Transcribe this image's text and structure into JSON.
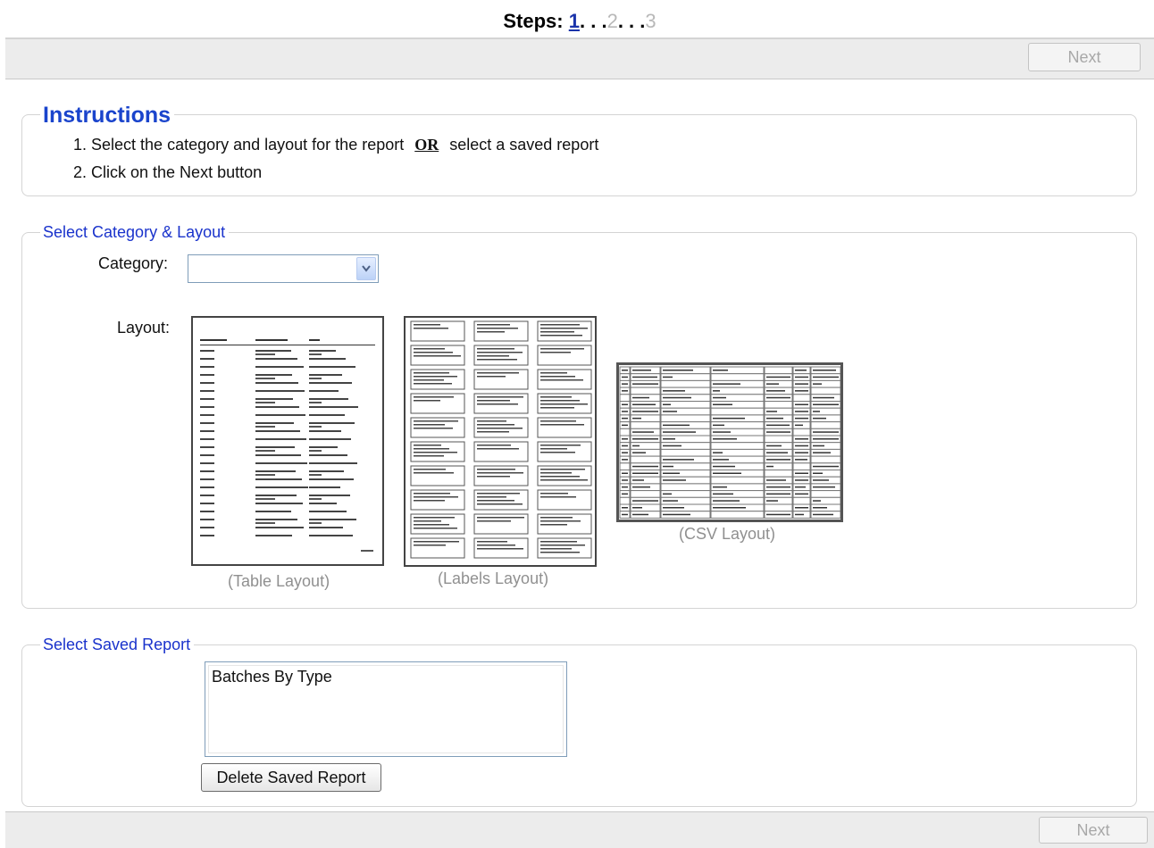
{
  "steps": {
    "prefix": "Steps:",
    "items": [
      {
        "label": "1",
        "state": "active"
      },
      {
        "label": "2",
        "state": "inactive"
      },
      {
        "label": "3",
        "state": "inactive"
      }
    ],
    "separator": ". . ."
  },
  "toolbar": {
    "next_label": "Next"
  },
  "instructions": {
    "title": "Instructions",
    "line1_before": "1. Select the category and layout for the report",
    "line1_or": "OR",
    "line1_after": "select a saved report",
    "line2": "2. Click on the Next button"
  },
  "category_layout": {
    "legend": "Select Category & Layout",
    "category_label": "Category:",
    "category_value": "",
    "layout_label": "Layout:",
    "layouts": [
      {
        "caption": "(Table Layout)"
      },
      {
        "caption": "(Labels Layout)"
      },
      {
        "caption": "(CSV Layout)"
      }
    ]
  },
  "saved_report": {
    "legend": "Select Saved Report",
    "items": [
      "Batches By Type"
    ],
    "delete_label": "Delete Saved Report"
  },
  "colors": {
    "accent": "#1a33cc",
    "toolbar_bg": "#ececec",
    "disabled_text": "#a8a8a8"
  }
}
